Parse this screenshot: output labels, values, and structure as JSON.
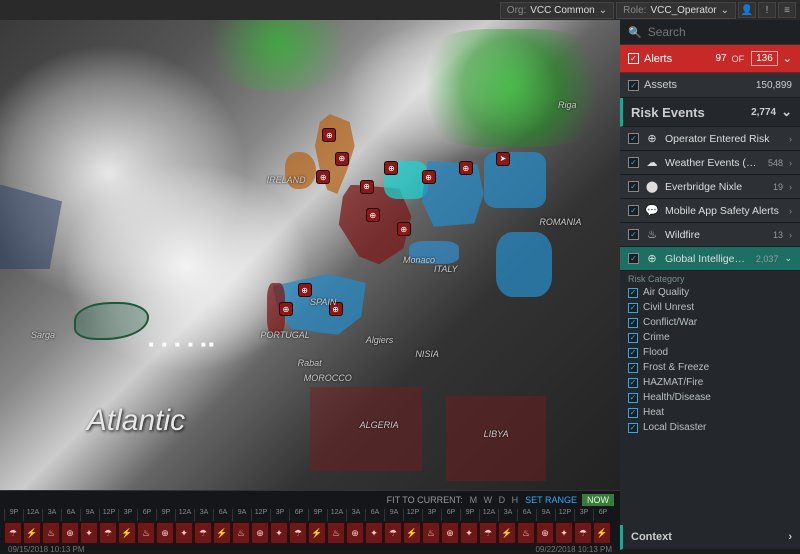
{
  "topbar": {
    "org_label": "Org:",
    "org_value": "VCC Common",
    "role_label": "Role:",
    "role_value": "VCC_Operator"
  },
  "search": {
    "placeholder": "Search"
  },
  "sections": {
    "alerts": {
      "title": "Alerts",
      "count_current": "97",
      "count_of": "OF",
      "count_total": "136"
    },
    "assets": {
      "title": "Assets",
      "count": "150,899"
    },
    "risk": {
      "title": "Risk Events",
      "count": "2,774"
    },
    "context": {
      "title": "Context"
    }
  },
  "risk_items": [
    {
      "icon": "⊕",
      "label": "Operator Entered Risk",
      "badge": ""
    },
    {
      "icon": "☁",
      "label": "Weather Events (US)",
      "badge": "548"
    },
    {
      "icon": "⬤",
      "label": "Everbridge Nixle",
      "badge": "19"
    },
    {
      "icon": "💬",
      "label": "Mobile App Safety Alerts",
      "badge": ""
    },
    {
      "icon": "♨",
      "label": "Wildfire",
      "badge": "13"
    },
    {
      "icon": "⊕",
      "label": "Global Intelligence Op...",
      "badge": "2,037",
      "active": true
    }
  ],
  "risk_category_title": "Risk Category",
  "risk_categories": [
    "Air Quality",
    "Civil Unrest",
    "Conflict/War",
    "Crime",
    "Flood",
    "Frost & Freeze",
    "HAZMAT/Fire",
    "Health/Disease",
    "Heat",
    "Local Disaster"
  ],
  "map_labels": {
    "atlantic": "Atlantic",
    "ireland": "IRELAND",
    "spain": "SPAIN",
    "portugal": "PORTUGAL",
    "morocco": "MOROCCO",
    "algeria": "ALGERIA",
    "italy": "ITALY",
    "romania": "ROMANIA",
    "libya": "LIBYA",
    "nisia": "NISIA",
    "algiers": "Algiers",
    "monaco": "Monaco",
    "rabat": "Rabat",
    "riga": "Riga",
    "sargasso": "Sarga"
  },
  "timeline": {
    "fit_label": "FIT TO CURRENT:",
    "letters": [
      "M",
      "W",
      "D",
      "H"
    ],
    "set_range": "SET RANGE",
    "now": "NOW",
    "hours": [
      "9P",
      "12A",
      "3A",
      "6A",
      "9A",
      "12P",
      "3P",
      "6P",
      "9P",
      "12A",
      "3A",
      "6A",
      "9A",
      "12P",
      "3P",
      "6P",
      "9P",
      "12A",
      "3A",
      "6A",
      "9A",
      "12P",
      "3P",
      "6P",
      "9P",
      "12A",
      "3A",
      "6A",
      "9A",
      "12P",
      "3P",
      "6P"
    ],
    "cells": [
      "☂",
      "⚡",
      "♨",
      "⊕",
      "✦",
      "☂",
      "⚡",
      "♨",
      "⊕",
      "✦",
      "☂",
      "⚡",
      "♨",
      "⊕",
      "✦",
      "☂",
      "⚡",
      "♨",
      "⊕",
      "✦",
      "☂",
      "⚡",
      "♨",
      "⊕",
      "✦",
      "☂",
      "⚡",
      "♨",
      "⊕",
      "✦",
      "☂",
      "⚡"
    ],
    "date_left": "09/15/2018 10:13 PM",
    "date_right": "09/22/2018 10:13 PM"
  }
}
